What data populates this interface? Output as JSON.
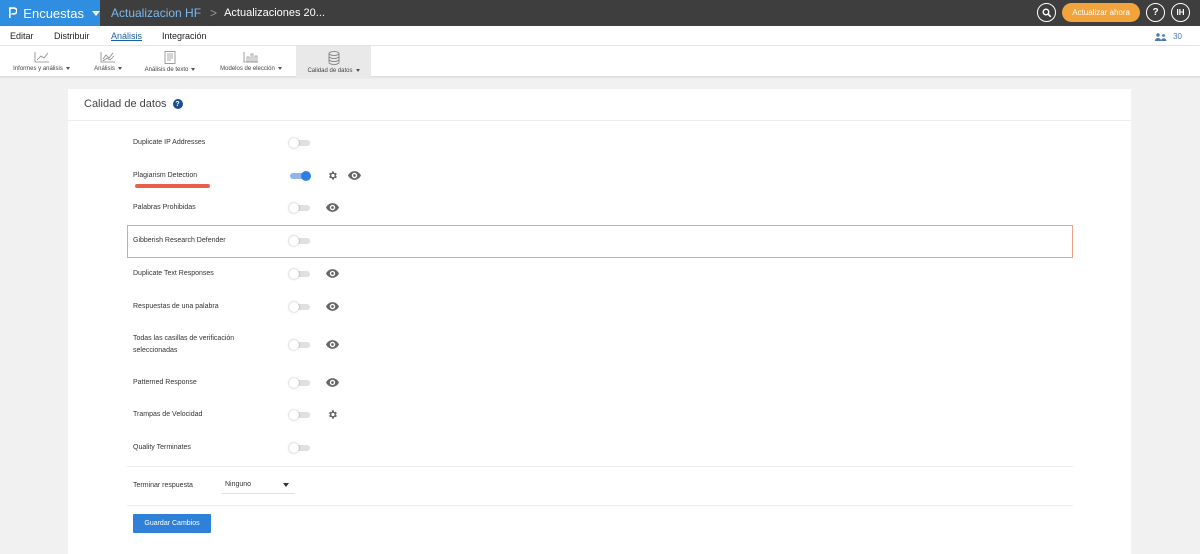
{
  "topbar": {
    "brand_label": "Encuestas",
    "breadcrumb_project": "Actualizacion HF",
    "breadcrumb_sep": ">",
    "breadcrumb_survey": "Actualizaciones 20...",
    "upgrade_label": "Actualizar ahora",
    "help_label": "?",
    "user_initials": "IH",
    "brand_color": "#2f8ee0",
    "upgrade_color": "#f3a33c"
  },
  "menu": {
    "items": [
      "Editar",
      "Distribuir",
      "Análisis",
      "Integración"
    ],
    "active": "Análisis",
    "users_count": "30"
  },
  "toolbar": {
    "items": [
      {
        "label": "Informes y análisis",
        "icon": "line-chart-icon"
      },
      {
        "label": "Análisis",
        "icon": "analysis-chart-icon"
      },
      {
        "label": "Análisis de texto",
        "icon": "text-document-icon"
      },
      {
        "label": "Modelos de elección",
        "icon": "bar-chart-icon"
      },
      {
        "label": "Calidad de datos",
        "icon": "database-icon"
      }
    ],
    "active": "Calidad de datos"
  },
  "panel": {
    "title": "Calidad de datos",
    "help_icon": "?",
    "rows": [
      {
        "label": "Duplicate IP Addresses",
        "enabled": false,
        "icons": []
      },
      {
        "label": "Plagiarism Detection",
        "enabled": true,
        "icons": [
          "gear-icon",
          "eye-icon"
        ]
      },
      {
        "label": "Palabras Prohibidas",
        "enabled": false,
        "icons": [
          "eye-icon"
        ]
      },
      {
        "label": "Gibberish Research Defender",
        "enabled": false,
        "icons": []
      },
      {
        "label": "Duplicate Text Responses",
        "enabled": false,
        "icons": [
          "eye-icon"
        ]
      },
      {
        "label": "Respuestas de una palabra",
        "enabled": false,
        "icons": [
          "eye-icon"
        ]
      },
      {
        "label": "Todas las casillas de verificación seleccionadas",
        "enabled": false,
        "icons": [
          "eye-icon"
        ]
      },
      {
        "label": "Patterned Response",
        "enabled": false,
        "icons": [
          "eye-icon"
        ]
      },
      {
        "label": "Trampas de Velocidad",
        "enabled": false,
        "icons": [
          "gear-icon"
        ]
      },
      {
        "label": "Quality Terminates",
        "enabled": false,
        "icons": []
      }
    ],
    "terminate_label": "Terminar respuesta",
    "terminate_value": "Ninguno",
    "save_label": "Guardar Cambios",
    "accent_color": "#2f80d8",
    "highlight_color": "#e8604c"
  }
}
